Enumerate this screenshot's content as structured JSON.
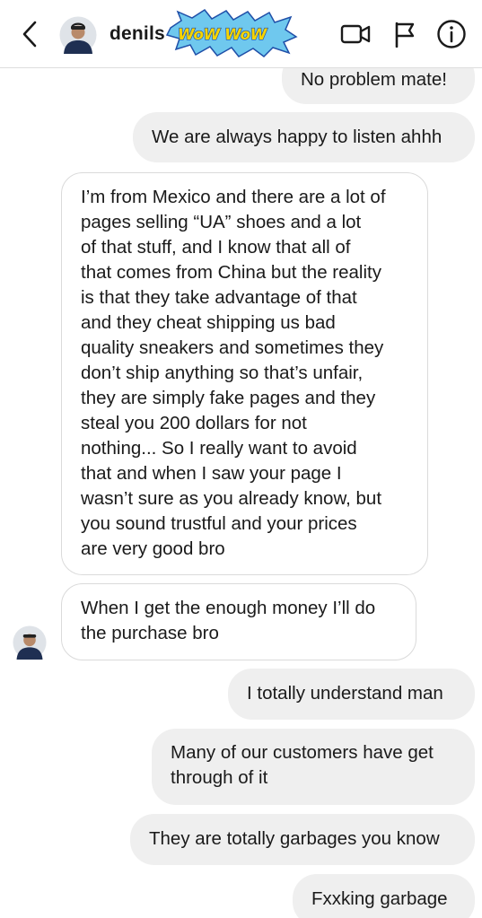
{
  "header": {
    "username": "denils",
    "sticker_text": "WoW WoW",
    "icons": [
      "back-chevron-icon",
      "video-camera-icon",
      "flag-icon",
      "info-icon"
    ]
  },
  "messages": [
    {
      "direction": "outgoing",
      "text": "No problem mate!"
    },
    {
      "direction": "outgoing",
      "text": "We are always happy to listen ahhh"
    },
    {
      "direction": "incoming",
      "lines": [
        "I’m from Mexico and there are a lot of",
        "pages selling “UA” shoes and a lot",
        "of that stuff, and I know that all of",
        "that comes from China but the reality",
        "is that they take advantage of that",
        "and they cheat shipping us bad",
        "quality sneakers and sometimes they",
        "don’t ship anything so that’s unfair,",
        "they are simply fake pages and they",
        "steal you 200 dollars for not",
        "nothing... So I really want to avoid",
        "that and when I saw your page I",
        "wasn’t sure as you already know, but",
        "you sound trustful and your prices",
        "are very good bro"
      ]
    },
    {
      "direction": "incoming",
      "lines": [
        "When I get the enough money I’ll do",
        "the purchase bro"
      ]
    },
    {
      "direction": "outgoing",
      "text": "I totally understand man"
    },
    {
      "direction": "outgoing",
      "lines": [
        "Many of our customers have get",
        "through of it"
      ]
    },
    {
      "direction": "outgoing",
      "text": "They are totally garbages you know"
    },
    {
      "direction": "outgoing",
      "text": "Fxxking garbage"
    }
  ],
  "colors": {
    "outgoing_bubble": "#efefef",
    "incoming_border": "#dadada",
    "text": "#1a1a1a"
  }
}
